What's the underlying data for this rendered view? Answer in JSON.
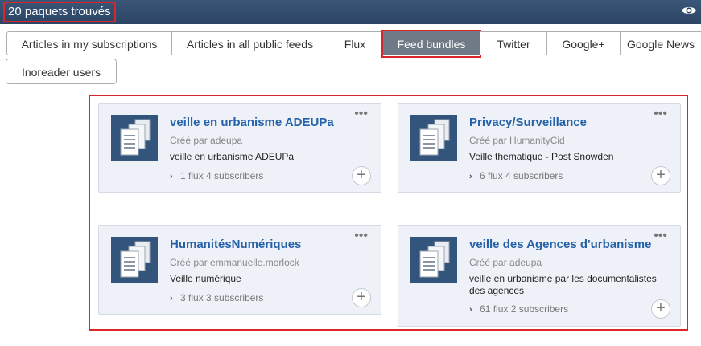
{
  "header": {
    "result_count": "20 paquets trouvés",
    "visibility_icon": "eye-icon",
    "background_color": "#2c4565"
  },
  "tabs": [
    {
      "label": "Articles in my subscriptions",
      "active": false
    },
    {
      "label": "Articles in all public feeds",
      "active": false
    },
    {
      "label": "Flux",
      "active": false
    },
    {
      "label": "Feed bundles",
      "active": true
    },
    {
      "label": "Twitter",
      "active": false
    },
    {
      "label": "Google+",
      "active": false
    },
    {
      "label": "Google News",
      "active": false
    },
    {
      "label": "Inoreader users",
      "active": false
    }
  ],
  "bundles": [
    {
      "title": "veille en urbanisme ADEUPa",
      "created_by_prefix": "Créé par",
      "author": "adeupa",
      "description": "veille en urbanisme ADEUPa",
      "flux": "1 flux",
      "subscribers": "4 subscribers"
    },
    {
      "title": "Privacy/Surveillance",
      "created_by_prefix": "Créé par",
      "author": "HumanityCid",
      "description": "Veille thematique - Post Snowden",
      "flux": "6 flux",
      "subscribers": "4 subscribers"
    },
    {
      "title": "HumanitésNumériques",
      "created_by_prefix": "Créé par",
      "author": "emmanuelle.morlock",
      "description": "Veille numérique",
      "flux": "3 flux",
      "subscribers": "3 subscribers"
    },
    {
      "title": "veille des Agences d'urbanisme",
      "created_by_prefix": "Créé par",
      "author": "adeupa",
      "description": "veille en urbanisme par les documentalistes des agences",
      "flux": "61 flux",
      "subscribers": "2 subscribers"
    }
  ],
  "icons": {
    "bundle": "bundle-documents-icon",
    "more": "more-icon",
    "add": "plus-icon",
    "stats": "chevron-right-icon"
  },
  "colors": {
    "accent_link": "#2561a8",
    "active_tab": "#6f7a86",
    "highlight": "#d9262b",
    "card_background": "#eef2f8"
  }
}
